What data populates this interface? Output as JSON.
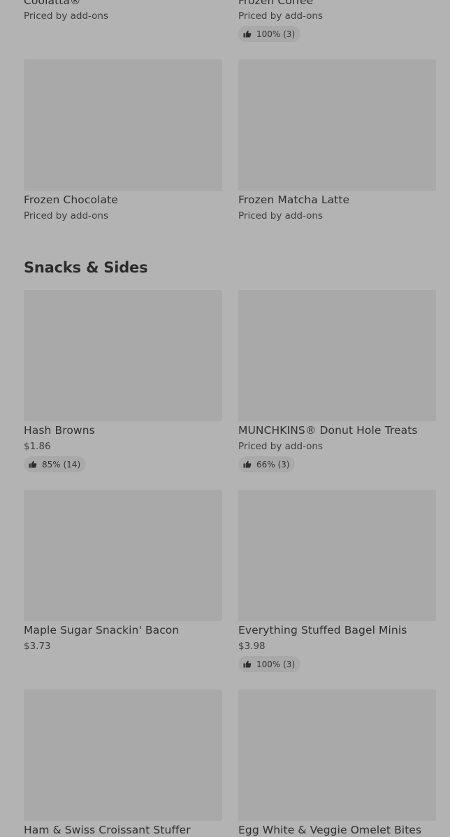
{
  "sections": [
    {
      "items": [
        {
          "name": "Coolatta®",
          "price": "Priced by add-ons",
          "rating": ""
        },
        {
          "name": "Frozen Coffee",
          "price": "Priced by add-ons",
          "rating": "100% (3)"
        },
        {
          "name": "Frozen Chocolate",
          "price": "Priced by add-ons",
          "rating": ""
        },
        {
          "name": "Frozen Matcha Latte",
          "price": "Priced by add-ons",
          "rating": ""
        }
      ]
    },
    {
      "title": "Snacks & Sides",
      "items": [
        {
          "name": "Hash Browns",
          "price": "$1.86",
          "rating": "85% (14)"
        },
        {
          "name": "MUNCHKINS® Donut Hole Treats",
          "price": "Priced by add-ons",
          "rating": "66% (3)"
        },
        {
          "name": "Maple Sugar Snackin' Bacon",
          "price": "$3.73",
          "rating": ""
        },
        {
          "name": "Everything Stuffed Bagel Minis",
          "price": "$3.98",
          "rating": "100% (3)"
        },
        {
          "name": "Ham & Swiss Croissant Stuffer",
          "price": "",
          "rating": ""
        },
        {
          "name": "Egg White & Veggie Omelet Bites",
          "price": "",
          "rating": ""
        }
      ]
    }
  ],
  "icons": {
    "rating": "thumbs-up-icon"
  }
}
